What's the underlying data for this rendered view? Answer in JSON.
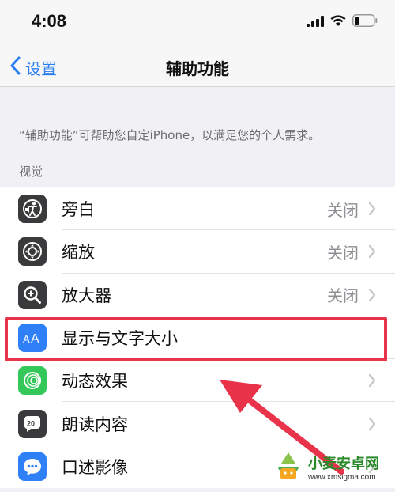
{
  "status_bar": {
    "time": "4:08"
  },
  "nav": {
    "back_label": "设置",
    "title": "辅助功能"
  },
  "description": "“辅助功能”可帮助您自定iPhone，以满足您的个人需求。",
  "section_header": "视觉",
  "rows": [
    {
      "label": "旁白",
      "value": "关闭",
      "icon": "voiceover-icon",
      "icon_bg": "#3a3a3c"
    },
    {
      "label": "缩放",
      "value": "关闭",
      "icon": "zoom-icon",
      "icon_bg": "#3a3a3c"
    },
    {
      "label": "放大器",
      "value": "关闭",
      "icon": "magnifier-icon",
      "icon_bg": "#3a3a3c"
    },
    {
      "label": "显示与文字大小",
      "value": "",
      "icon": "text-size-icon",
      "icon_bg": "#2f7ff6"
    },
    {
      "label": "动态效果",
      "value": "",
      "icon": "motion-icon",
      "icon_bg": "#34c759"
    },
    {
      "label": "朗读内容",
      "value": "",
      "icon": "spoken-content-icon",
      "icon_bg": "#3a3a3c"
    },
    {
      "label": "口述影像",
      "value": "",
      "icon": "audio-descriptions-icon",
      "icon_bg": "#2f7ff6"
    }
  ],
  "watermark": {
    "main": "小麦安卓网",
    "sub": "www.xmsigma.com"
  },
  "colors": {
    "accent": "#2a7ef4",
    "highlight": "#e8334a",
    "background": "#f0f0f5"
  }
}
